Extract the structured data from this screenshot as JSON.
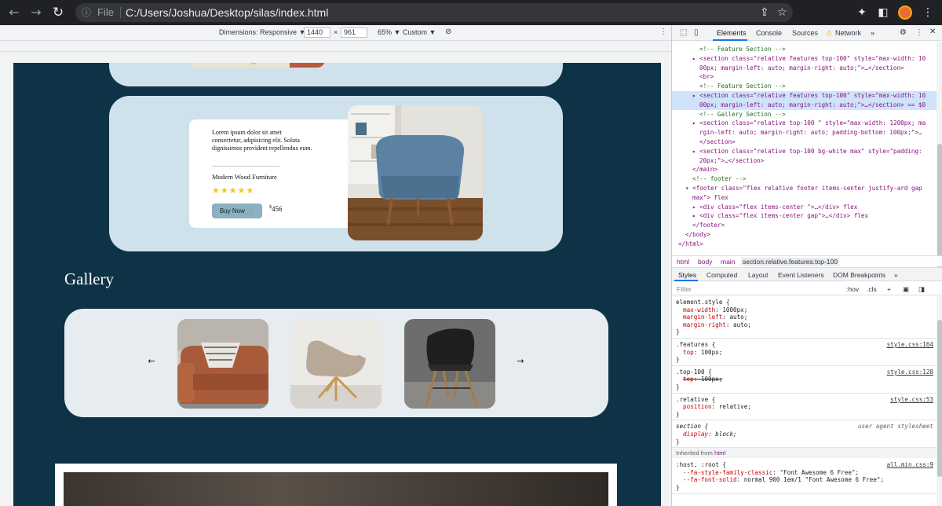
{
  "browser": {
    "scheme": "File",
    "url": "C:/Users/Joshua/Desktop/silas/index.html"
  },
  "device_toolbar": {
    "dimensions_label": "Dimensions: Responsive ▼",
    "width": "1440",
    "times": "×",
    "height": "961",
    "zoom": "65% ▼",
    "throttle": "Custom ▼"
  },
  "page": {
    "feature": {
      "lorem": "Lorem ipsum dolor sit amet consectetur, adipisicing elit. Soluta dignissimos provident repellendus eum.",
      "product_name": "Modern Wood Furniture",
      "stars": "★★★★★",
      "rating": 5,
      "buy_label": "Buy Now 🛒",
      "price_symbol": "$",
      "price": "456"
    },
    "gallery": {
      "title": "Gallery",
      "prev": "←",
      "next": "→"
    }
  },
  "devtools": {
    "tabs": [
      "Elements",
      "Console",
      "Sources",
      "Network"
    ],
    "more": "»",
    "network_warning": "⚠",
    "elements_lines": [
      {
        "t": "<!-- Feature Section -->",
        "cls": "c-com",
        "indent": 3
      },
      {
        "t": "▸ <section class=\"relative features top-100\" style=\"max-width: 10",
        "cls": "c-tag",
        "indent": 2
      },
      {
        "t": "00px; margin-left: auto; margin-right: auto;\">…</section>",
        "cls": "c-tag",
        "indent": 3
      },
      {
        "t": "<br>",
        "cls": "c-tag",
        "indent": 3
      },
      {
        "t": "<!-- Feature Section -->",
        "cls": "c-com",
        "indent": 3
      },
      {
        "t": "▸ <section class=\"relative features top-100\" style=\"max-width: 10",
        "cls": "c-tag",
        "indent": 2,
        "hl": true
      },
      {
        "t": "00px; margin-left: auto; margin-right: auto;\">…</section> == $0",
        "cls": "c-tag",
        "indent": 3,
        "hl": true
      },
      {
        "t": "<!-- Gallery Section -->",
        "cls": "c-com",
        "indent": 3
      },
      {
        "t": "▸ <section class=\"relative top-100 \" style=\"max-width: 1200px; ma",
        "cls": "c-tag",
        "indent": 2
      },
      {
        "t": "rgin-left: auto; margin-right: auto; padding-bottom: 100px;\">…",
        "cls": "c-tag",
        "indent": 3
      },
      {
        "t": "</section>",
        "cls": "c-tag",
        "indent": 3
      },
      {
        "t": "▸ <section class=\"relative top-100 bg-white max\" style=\"padding:",
        "cls": "c-tag",
        "indent": 2
      },
      {
        "t": "20px;\">…</section>",
        "cls": "c-tag",
        "indent": 3
      },
      {
        "t": "</main>",
        "cls": "c-tag",
        "indent": 2
      },
      {
        "t": "<!-- footer -->",
        "cls": "c-com",
        "indent": 2
      },
      {
        "t": "▾ <footer class=\"flex relative footer items-center justify-ard gap",
        "cls": "c-tag",
        "indent": 1
      },
      {
        "t": "max\"> flex",
        "cls": "c-tag",
        "indent": 2
      },
      {
        "t": "▸ <div class=\"flex items-center \">…</div> flex",
        "cls": "c-tag",
        "indent": 2
      },
      {
        "t": "▸ <div class=\"flex items-center gap\">…</div> flex",
        "cls": "c-tag",
        "indent": 2
      },
      {
        "t": "</footer>",
        "cls": "c-tag",
        "indent": 2
      },
      {
        "t": "</body>",
        "cls": "c-tag",
        "indent": 1
      },
      {
        "t": "</html>",
        "cls": "c-tag",
        "indent": 0
      }
    ],
    "breadcrumbs": [
      "html",
      "body",
      "main",
      "section.relative.features.top-100"
    ],
    "sub_tabs": [
      "Styles",
      "Computed",
      "Layout",
      "Event Listeners",
      "DOM Breakpoints",
      "»"
    ],
    "filter": {
      "placeholder": "Filter",
      "hov": ":hov",
      "cls": ".cls",
      "plus": "+"
    },
    "style_rules": [
      {
        "selector": "element.style {",
        "source": "",
        "props": [
          [
            "max-width",
            "1000px;"
          ],
          [
            "margin-left",
            "auto;"
          ],
          [
            "margin-right",
            "auto;"
          ]
        ]
      },
      {
        "selector": ".features {",
        "source": "style.css:164",
        "props": [
          [
            "top",
            "100px;"
          ]
        ]
      },
      {
        "selector": ".top-100 {",
        "source": "style.css:128",
        "props": [
          [
            "top",
            "100px;"
          ]
        ],
        "struck": true
      },
      {
        "selector": ".relative {",
        "source": "style.css:53",
        "props": [
          [
            "position",
            "relative;"
          ]
        ]
      },
      {
        "selector": "section {",
        "source": "user agent stylesheet",
        "props": [
          [
            "display",
            "block;"
          ]
        ],
        "italic": true
      }
    ],
    "inherited_label": "Inherited from",
    "inherited_from": "html",
    "root_rule": {
      "selector": ":host, :root {",
      "source": "all.min.css:9",
      "props": [
        [
          "--fa-style-family-classic",
          "\"Font Awesome 6 Free\";"
        ],
        [
          "--fa-font-solid",
          "normal 900 1em/1 \"Font Awesome 6 Free\";"
        ]
      ]
    }
  }
}
